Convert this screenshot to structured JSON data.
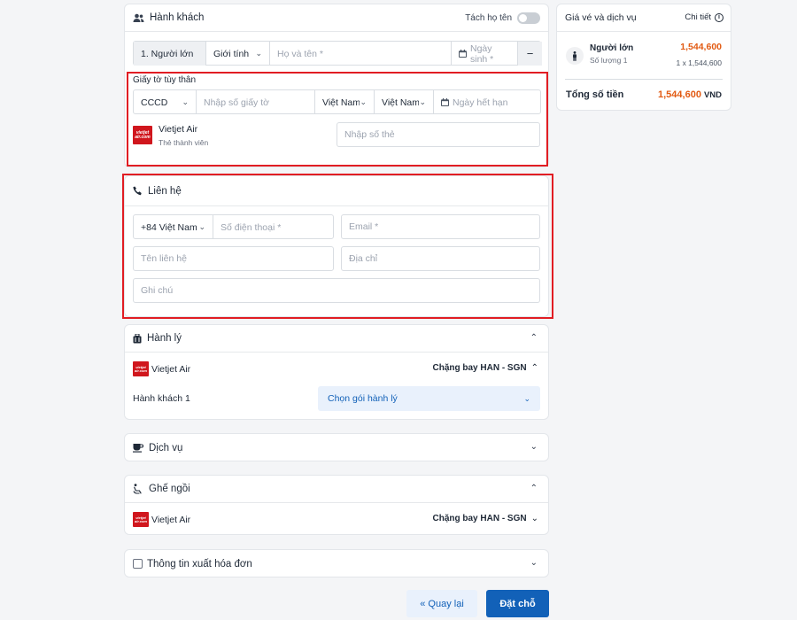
{
  "passenger": {
    "title": "Hành khách",
    "split_name_label": "Tách họ tên",
    "type_label": "1. Người lớn",
    "gender_label": "Giới tính",
    "fullname_placeholder": "Họ và tên *",
    "dob_placeholder": "Ngày sinh *",
    "remove_label": "−"
  },
  "id_doc": {
    "title": "Giấy tờ tùy thân",
    "doc_type": "CCCD",
    "doc_number_placeholder": "Nhập số giấy tờ",
    "nationality": "Việt Nam",
    "issuing_country": "Việt Nam",
    "expiry_placeholder": "Ngày hết hạn",
    "airline": "Vietjet Air",
    "member_label": "Thẻ thành viên",
    "card_placeholder": "Nhập số thẻ"
  },
  "contact": {
    "title": "Liên hệ",
    "country_code": "+84 Việt Nam",
    "phone_placeholder": "Số điện thoại *",
    "email_placeholder": "Email *",
    "name_placeholder": "Tên liên hệ",
    "address_placeholder": "Địa chỉ",
    "note_placeholder": "Ghi chú"
  },
  "baggage": {
    "title": "Hành lý",
    "airline": "Vietjet Air",
    "segment": "Chặng bay HAN - SGN",
    "passenger": "Hành khách 1",
    "select_label": "Chọn gói hành lý"
  },
  "services": {
    "title": "Dịch vụ"
  },
  "seats": {
    "title": "Ghế ngồi",
    "airline": "Vietjet Air",
    "segment": "Chặng bay HAN - SGN"
  },
  "invoice": {
    "title": "Thông tin xuất hóa đơn"
  },
  "actions": {
    "back": "« Quay lại",
    "book": "Đặt chỗ"
  },
  "summary": {
    "title": "Giá vé và dịch vụ",
    "detail": "Chi tiết",
    "adult_label": "Người lớn",
    "quantity_label": "Số lượng 1",
    "adult_price": "1,544,600",
    "adult_calc": "1 x 1,544,600",
    "total_label": "Tổng số tiền",
    "total_value": "1,544,600",
    "currency": "VND"
  },
  "colors": {
    "accent_red": "#e11d23",
    "price_orange": "#e25a12",
    "primary_blue": "#1261b8",
    "select_bg": "#e9f1fc"
  }
}
